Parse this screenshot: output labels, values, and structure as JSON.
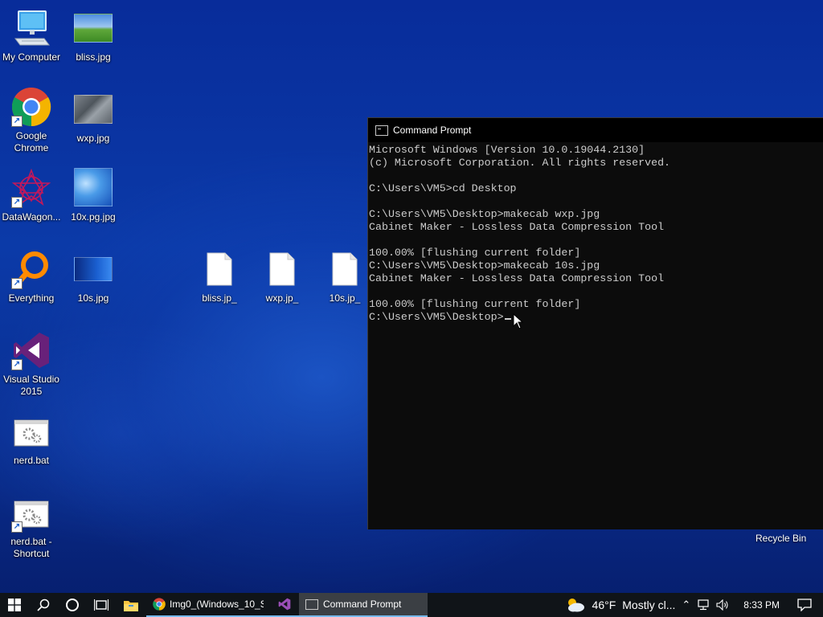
{
  "desktop": {
    "icons": [
      {
        "label": "My Computer",
        "icon": "computer-icon"
      },
      {
        "label": "bliss.jpg",
        "icon": "image-thumbnail"
      },
      {
        "label": "Google Chrome",
        "icon": "chrome-icon"
      },
      {
        "label": "wxp.jpg",
        "icon": "image-thumbnail"
      },
      {
        "label": "DataWagon...",
        "icon": "datawagon-icon"
      },
      {
        "label": "10x.pg.jpg",
        "icon": "image-thumbnail"
      },
      {
        "label": "Everything",
        "icon": "everything-icon"
      },
      {
        "label": "10s.jpg",
        "icon": "image-thumbnail"
      },
      {
        "label": "bliss.jp_",
        "icon": "file-icon"
      },
      {
        "label": "wxp.jp_",
        "icon": "file-icon"
      },
      {
        "label": "10s.jp_",
        "icon": "file-icon"
      },
      {
        "label": "Visual Studio 2015",
        "icon": "visual-studio-icon"
      },
      {
        "label": "nerd.bat",
        "icon": "batch-file-icon"
      },
      {
        "label": "nerd.bat - Shortcut",
        "icon": "batch-file-icon"
      }
    ],
    "recycle_bin_label": "Recycle Bin"
  },
  "cmd_window": {
    "title": "Command Prompt",
    "lines": [
      "Microsoft Windows [Version 10.0.19044.2130]",
      "(c) Microsoft Corporation. All rights reserved.",
      "",
      "C:\\Users\\VM5>cd Desktop",
      "",
      "C:\\Users\\VM5\\Desktop>makecab wxp.jpg",
      "Cabinet Maker - Lossless Data Compression Tool",
      "",
      "100.00% [flushing current folder]",
      "C:\\Users\\VM5\\Desktop>makecab 10s.jpg",
      "Cabinet Maker - Lossless Data Compression Tool",
      "",
      "100.00% [flushing current folder]",
      "C:\\Users\\VM5\\Desktop>"
    ]
  },
  "taskbar": {
    "apps": [
      {
        "label": "Img0_(Windows_10_S...",
        "icon": "chrome-icon"
      },
      {
        "label": "",
        "icon": "visual-studio-icon"
      },
      {
        "label": "Command Prompt",
        "icon": "cmd-icon"
      }
    ],
    "weather": {
      "temp": "46°F",
      "desc": "Mostly cl...",
      "icon": "weather-cloud-sun-icon"
    },
    "clock": "8:33 PM"
  }
}
